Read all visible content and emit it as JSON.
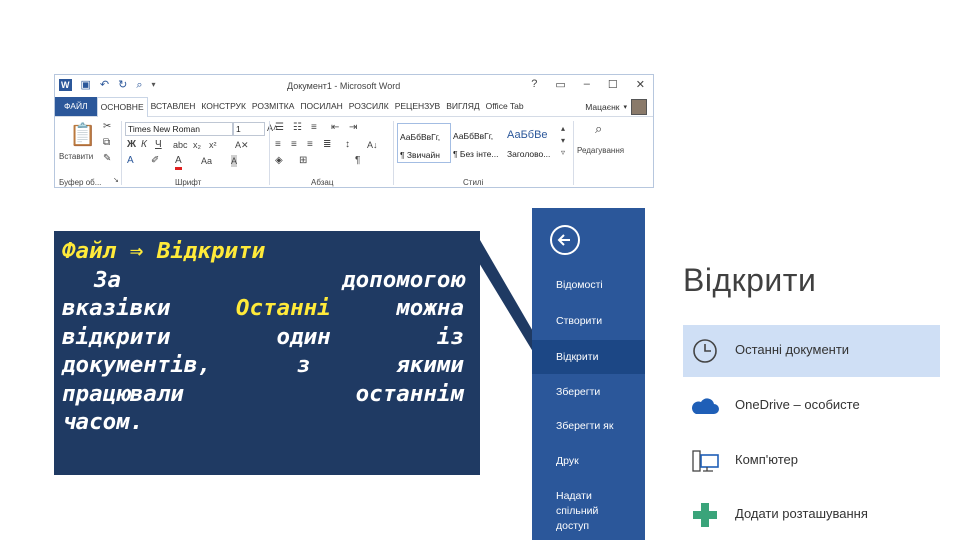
{
  "word": {
    "qat_icons": [
      "word-icon",
      "save-icon",
      "undo-icon",
      "redo-icon",
      "print-preview-icon"
    ],
    "doc_title": "Документ1 - Microsoft Word",
    "window_controls": [
      "?",
      "▭",
      "–",
      "☐",
      "✕"
    ],
    "tabs": [
      "ФАЙЛ",
      "ОСНОВНЕ",
      "ВСТАВЛЕН",
      "КОНСТРУК",
      "РОЗМІТКА",
      "ПОСИЛАН",
      "РОЗСИЛК",
      "РЕЦЕНЗУВ",
      "ВИГЛЯД",
      "Office Tab"
    ],
    "user_name": "Мацаєнк",
    "paste_label": "Вставити",
    "font_name": "Times New Roman",
    "font_size": "1",
    "styles": [
      {
        "line1": "АаБбВвГг,",
        "line2": "¶ Звичайн"
      },
      {
        "line1": "АаБбВвГг,",
        "line2": "¶ Без інте..."
      },
      {
        "line1": "АаБбВе",
        "line2": "Заголово..."
      }
    ],
    "editing_label": "Редагування",
    "group_labels": {
      "clipboard": "Буфер об...",
      "font": "Шрифт",
      "paragraph": "Абзац",
      "styles": "Стилі"
    }
  },
  "textbox": {
    "line1_a": "Файл",
    "line1_arrow": "⇒",
    "line1_b": "Відкрити",
    "line2_a": "За",
    "line2_b": "допомогою",
    "line3_a": "вказівки",
    "line3_b": "Останні",
    "line3_c": "можна",
    "line4_a": "відкрити",
    "line4_b": "один",
    "line4_c": "із",
    "line5_a": "документів,",
    "line5_b": "з",
    "line5_c": "якими",
    "line6_a": "працювали",
    "line6_b": "останнім",
    "line7": "часом."
  },
  "backstage": {
    "items": [
      "Відомості",
      "Створити",
      "Відкрити",
      "Зберегти",
      "Зберегти як",
      "Друк",
      "Надати спільний доступ"
    ],
    "active": "Відкрити"
  },
  "open_pane": {
    "title": "Відкрити",
    "locations": [
      {
        "label": "Останні документи",
        "icon": "clock-icon",
        "selected": true
      },
      {
        "label": "OneDrive – особисте",
        "icon": "cloud-icon",
        "selected": false
      },
      {
        "label": "Комп'ютер",
        "icon": "computer-icon",
        "selected": false
      },
      {
        "label": "Додати розташування",
        "icon": "plus-icon",
        "selected": false
      }
    ]
  },
  "colors": {
    "word_blue": "#2b579a",
    "active_item": "#1c4785",
    "textbox_bg": "#1f3a63",
    "highlight_text": "#ffea3a",
    "selected_location": "#cfdff5",
    "onedrive_blue": "#1f5fb7",
    "plus_green": "#3aa47a"
  }
}
